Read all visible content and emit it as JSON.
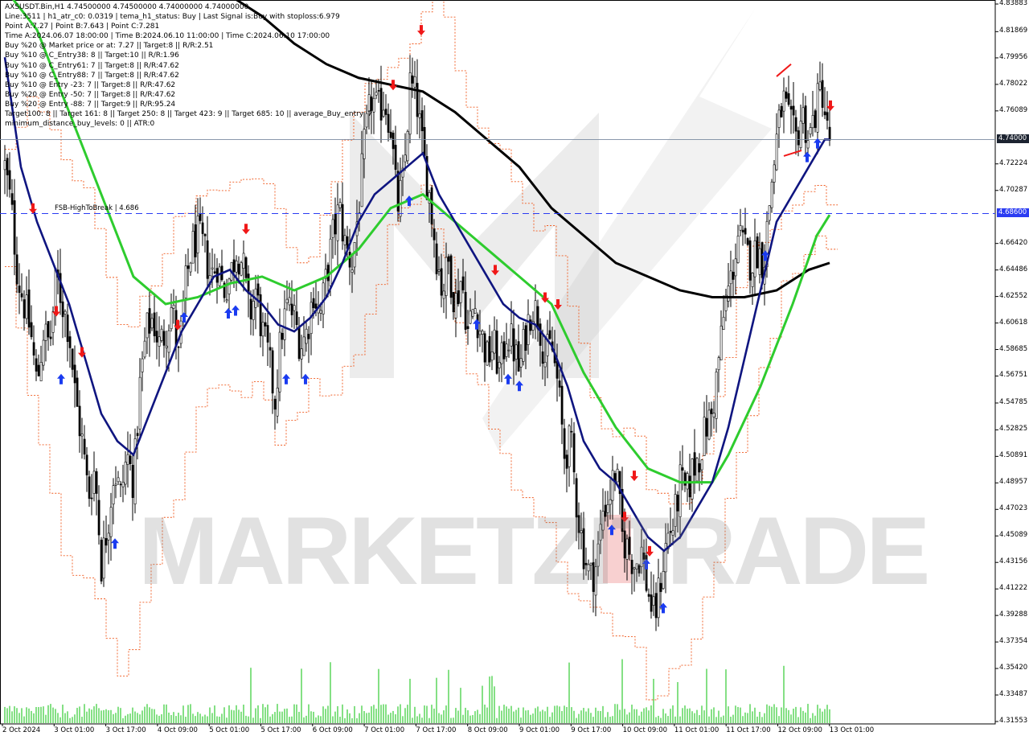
{
  "info": {
    "lines": [
      "AXSUSDT.Bin,H1  4.74500000 4.74500000 4.74000000 4.74000000",
      "Line:3511  | h1_atr_c0: 0.0319  | tema_h1_status: Buy  | Last Signal is:Buy with stoploss:6.979",
      "Point A:7.27  | Point B:7.643  | Point C:7.281",
      "Time A:2024.06.07 18:00:00  | Time B:2024.06.10 11:00:00  | Time C:2024.06.10 17:00:00",
      "Buy %20 @ Market price or at: 7.27  || Target:8  || R/R:2.51",
      "Buy %10 @ C_Entry38: 8  || Target:10  || R/R:1.96",
      "Buy %10 @ C_Entry61: 7  || Target:8  || R/R:47.62",
      "Buy %10 @ C_Entry88: 7  || Target:8  || R/R:47.62",
      "Buy %10 @ Entry -23: 7  || Target:8  || R/R:47.62",
      "Buy %20 @ Entry -50: 7  || Target:8  || R/R:47.62",
      "Buy %20 @ Entry -88: 7  || Target:9  || R/R:95.24",
      "Target100: 8  || Target 161: 8  || Target 250: 8  || Target 423: 9  || Target 685: 10  || average_Buy_entry: 7",
      "minimum_distance_buy_levels: 0  || ATR:0"
    ]
  },
  "fsb_label": "FSB-HighToBreak  | 4.686",
  "watermark": "MARKETZITRADE",
  "price_tags": {
    "current": "4.74000",
    "level": "4.68600"
  },
  "colors": {
    "bull": "#000000",
    "bear": "#000000",
    "ema_fast": "#0f1580",
    "ema_mid": "#2ecc2e",
    "ema_slow": "#000000",
    "envelope": "#f05a1e",
    "volume": "#33cc33",
    "buy_arrow": "#1a3bf0",
    "sell_arrow": "#f01818",
    "level_line": "#2b3cf2"
  },
  "chart_data": {
    "type": "candlestick",
    "symbol": "AXSUSDT.Bin",
    "timeframe": "H1",
    "ylim": [
      4.31553,
      4.83883
    ],
    "y_ticks": [
      "4.83883",
      "4.81869",
      "4.79956",
      "4.78022",
      "4.76089",
      "4.74000",
      "4.72224",
      "4.70287",
      "4.68600",
      "4.66420",
      "4.64486",
      "4.62552",
      "4.60618",
      "4.58685",
      "4.56751",
      "4.54785",
      "4.52825",
      "4.50891",
      "4.48957",
      "4.47023",
      "4.45089",
      "4.43156",
      "4.41222",
      "4.39288",
      "4.37354",
      "4.35420",
      "4.33487",
      "4.31553"
    ],
    "x_ticks": [
      "2 Oct 2024",
      "3 Oct 01:00",
      "3 Oct 17:00",
      "4 Oct 09:00",
      "5 Oct 01:00",
      "5 Oct 17:00",
      "6 Oct 09:00",
      "7 Oct 01:00",
      "7 Oct 17:00",
      "8 Oct 09:00",
      "9 Oct 01:00",
      "9 Oct 17:00",
      "10 Oct 09:00",
      "11 Oct 01:00",
      "11 Oct 17:00",
      "12 Oct 09:00",
      "13 Oct 01:00"
    ],
    "horizontal_levels": [
      {
        "name": "current price",
        "value": 4.74
      },
      {
        "name": "FSB-HighToBreak",
        "value": 4.686
      }
    ],
    "close_path": [
      [
        0,
        4.72
      ],
      [
        8,
        4.69
      ],
      [
        16,
        4.64
      ],
      [
        24,
        4.62
      ],
      [
        32,
        4.6
      ],
      [
        40,
        4.56
      ],
      [
        48,
        4.6
      ],
      [
        56,
        4.59
      ],
      [
        64,
        4.64
      ],
      [
        72,
        4.62
      ],
      [
        80,
        4.6
      ],
      [
        88,
        4.55
      ],
      [
        96,
        4.52
      ],
      [
        104,
        4.48
      ],
      [
        112,
        4.5
      ],
      [
        120,
        4.43
      ],
      [
        128,
        4.46
      ],
      [
        136,
        4.5
      ],
      [
        144,
        4.48
      ],
      [
        152,
        4.51
      ],
      [
        160,
        4.49
      ],
      [
        168,
        4.56
      ],
      [
        176,
        4.6
      ],
      [
        184,
        4.61
      ],
      [
        192,
        4.59
      ],
      [
        200,
        4.6
      ],
      [
        208,
        4.62
      ],
      [
        216,
        4.58
      ],
      [
        224,
        4.63
      ],
      [
        232,
        4.66
      ],
      [
        240,
        4.67
      ],
      [
        248,
        4.66
      ],
      [
        256,
        4.64
      ],
      [
        264,
        4.65
      ],
      [
        272,
        4.63
      ],
      [
        280,
        4.64
      ],
      [
        288,
        4.66
      ],
      [
        296,
        4.65
      ],
      [
        304,
        4.61
      ],
      [
        312,
        4.63
      ],
      [
        320,
        4.6
      ],
      [
        328,
        4.58
      ],
      [
        336,
        4.55
      ],
      [
        344,
        4.6
      ],
      [
        352,
        4.62
      ],
      [
        360,
        4.61
      ],
      [
        368,
        4.59
      ],
      [
        376,
        4.6
      ],
      [
        384,
        4.63
      ],
      [
        392,
        4.61
      ],
      [
        400,
        4.64
      ],
      [
        408,
        4.67
      ],
      [
        416,
        4.69
      ],
      [
        424,
        4.66
      ],
      [
        432,
        4.65
      ],
      [
        440,
        4.69
      ],
      [
        448,
        4.74
      ],
      [
        456,
        4.77
      ],
      [
        464,
        4.76
      ],
      [
        472,
        4.77
      ],
      [
        480,
        4.75
      ],
      [
        488,
        4.69
      ],
      [
        496,
        4.71
      ],
      [
        504,
        4.78
      ],
      [
        512,
        4.77
      ],
      [
        520,
        4.73
      ],
      [
        528,
        4.7
      ],
      [
        536,
        4.66
      ],
      [
        544,
        4.63
      ],
      [
        552,
        4.65
      ],
      [
        560,
        4.62
      ],
      [
        568,
        4.64
      ],
      [
        576,
        4.6
      ],
      [
        584,
        4.62
      ],
      [
        592,
        4.6
      ],
      [
        600,
        4.58
      ],
      [
        608,
        4.59
      ],
      [
        616,
        4.57
      ],
      [
        624,
        4.6
      ],
      [
        632,
        4.59
      ],
      [
        640,
        4.57
      ],
      [
        648,
        4.6
      ],
      [
        656,
        4.62
      ],
      [
        664,
        4.61
      ],
      [
        672,
        4.58
      ],
      [
        680,
        4.59
      ],
      [
        688,
        4.56
      ],
      [
        696,
        4.51
      ],
      [
        704,
        4.52
      ],
      [
        712,
        4.47
      ],
      [
        720,
        4.44
      ],
      [
        728,
        4.42
      ],
      [
        736,
        4.43
      ],
      [
        744,
        4.47
      ],
      [
        752,
        4.48
      ],
      [
        760,
        4.5
      ],
      [
        768,
        4.45
      ],
      [
        776,
        4.44
      ],
      [
        784,
        4.43
      ],
      [
        792,
        4.44
      ],
      [
        800,
        4.41
      ],
      [
        808,
        4.39
      ],
      [
        816,
        4.42
      ],
      [
        824,
        4.45
      ],
      [
        832,
        4.46
      ],
      [
        840,
        4.49
      ],
      [
        848,
        4.48
      ],
      [
        856,
        4.5
      ],
      [
        864,
        4.51
      ],
      [
        872,
        4.53
      ],
      [
        880,
        4.54
      ],
      [
        888,
        4.58
      ],
      [
        896,
        4.62
      ],
      [
        904,
        4.64
      ],
      [
        912,
        4.67
      ],
      [
        920,
        4.66
      ],
      [
        928,
        4.65
      ],
      [
        936,
        4.66
      ],
      [
        944,
        4.65
      ],
      [
        952,
        4.7
      ],
      [
        960,
        4.74
      ],
      [
        968,
        4.77
      ],
      [
        976,
        4.75
      ],
      [
        984,
        4.74
      ],
      [
        992,
        4.76
      ],
      [
        1000,
        4.74
      ],
      [
        1008,
        4.76
      ],
      [
        1016,
        4.78
      ],
      [
        1024,
        4.74
      ]
    ],
    "ema_fast": [
      [
        0,
        4.8
      ],
      [
        20,
        4.72
      ],
      [
        40,
        4.68
      ],
      [
        60,
        4.65
      ],
      [
        80,
        4.62
      ],
      [
        100,
        4.58
      ],
      [
        120,
        4.54
      ],
      [
        140,
        4.52
      ],
      [
        160,
        4.51
      ],
      [
        180,
        4.54
      ],
      [
        200,
        4.57
      ],
      [
        220,
        4.6
      ],
      [
        240,
        4.62
      ],
      [
        260,
        4.64
      ],
      [
        280,
        4.645
      ],
      [
        300,
        4.63
      ],
      [
        320,
        4.62
      ],
      [
        340,
        4.605
      ],
      [
        360,
        4.6
      ],
      [
        380,
        4.61
      ],
      [
        400,
        4.625
      ],
      [
        420,
        4.65
      ],
      [
        440,
        4.68
      ],
      [
        460,
        4.7
      ],
      [
        480,
        4.71
      ],
      [
        500,
        4.72
      ],
      [
        520,
        4.73
      ],
      [
        540,
        4.7
      ],
      [
        560,
        4.68
      ],
      [
        580,
        4.66
      ],
      [
        600,
        4.64
      ],
      [
        620,
        4.62
      ],
      [
        640,
        4.61
      ],
      [
        660,
        4.605
      ],
      [
        680,
        4.59
      ],
      [
        700,
        4.56
      ],
      [
        720,
        4.52
      ],
      [
        740,
        4.5
      ],
      [
        760,
        4.49
      ],
      [
        780,
        4.47
      ],
      [
        800,
        4.45
      ],
      [
        820,
        4.44
      ],
      [
        840,
        4.45
      ],
      [
        860,
        4.47
      ],
      [
        880,
        4.49
      ],
      [
        900,
        4.53
      ],
      [
        920,
        4.58
      ],
      [
        940,
        4.63
      ],
      [
        960,
        4.68
      ],
      [
        980,
        4.7
      ],
      [
        1000,
        4.72
      ],
      [
        1020,
        4.74
      ],
      [
        1026,
        4.74
      ]
    ],
    "ema_mid": [
      [
        0,
        4.85
      ],
      [
        40,
        4.82
      ],
      [
        80,
        4.76
      ],
      [
        120,
        4.7
      ],
      [
        160,
        4.64
      ],
      [
        200,
        4.62
      ],
      [
        240,
        4.625
      ],
      [
        280,
        4.635
      ],
      [
        320,
        4.64
      ],
      [
        360,
        4.63
      ],
      [
        400,
        4.64
      ],
      [
        440,
        4.66
      ],
      [
        480,
        4.69
      ],
      [
        520,
        4.7
      ],
      [
        560,
        4.68
      ],
      [
        600,
        4.66
      ],
      [
        640,
        4.64
      ],
      [
        680,
        4.62
      ],
      [
        720,
        4.57
      ],
      [
        760,
        4.53
      ],
      [
        800,
        4.5
      ],
      [
        840,
        4.49
      ],
      [
        880,
        4.49
      ],
      [
        900,
        4.51
      ],
      [
        940,
        4.56
      ],
      [
        980,
        4.62
      ],
      [
        1010,
        4.67
      ],
      [
        1026,
        4.685
      ]
    ],
    "ema_slow": [
      [
        160,
        4.86
      ],
      [
        200,
        4.855
      ],
      [
        240,
        4.85
      ],
      [
        280,
        4.845
      ],
      [
        320,
        4.83
      ],
      [
        360,
        4.81
      ],
      [
        400,
        4.795
      ],
      [
        440,
        4.785
      ],
      [
        480,
        4.78
      ],
      [
        520,
        4.775
      ],
      [
        560,
        4.76
      ],
      [
        600,
        4.74
      ],
      [
        640,
        4.72
      ],
      [
        680,
        4.69
      ],
      [
        720,
        4.67
      ],
      [
        760,
        4.65
      ],
      [
        800,
        4.64
      ],
      [
        840,
        4.63
      ],
      [
        880,
        4.625
      ],
      [
        920,
        4.625
      ],
      [
        960,
        4.63
      ],
      [
        1000,
        4.645
      ],
      [
        1026,
        4.65
      ]
    ],
    "envelope_upper": [
      [
        0,
        4.73
      ],
      [
        20,
        4.76
      ],
      [
        40,
        4.77
      ],
      [
        60,
        4.74
      ],
      [
        80,
        4.7
      ],
      [
        100,
        4.7
      ],
      [
        120,
        4.65
      ],
      [
        140,
        4.6
      ],
      [
        160,
        4.61
      ],
      [
        180,
        4.64
      ],
      [
        200,
        4.66
      ],
      [
        220,
        4.69
      ],
      [
        240,
        4.7
      ],
      [
        260,
        4.7
      ],
      [
        280,
        4.7
      ],
      [
        300,
        4.71
      ],
      [
        320,
        4.7
      ],
      [
        340,
        4.68
      ],
      [
        360,
        4.66
      ],
      [
        380,
        4.66
      ],
      [
        400,
        4.7
      ],
      [
        420,
        4.73
      ],
      [
        440,
        4.77
      ],
      [
        460,
        4.79
      ],
      [
        480,
        4.8
      ],
      [
        500,
        4.81
      ],
      [
        520,
        4.83
      ],
      [
        540,
        4.84
      ],
      [
        560,
        4.8
      ],
      [
        580,
        4.76
      ],
      [
        600,
        4.74
      ],
      [
        620,
        4.72
      ],
      [
        640,
        4.7
      ],
      [
        660,
        4.68
      ],
      [
        680,
        4.66
      ],
      [
        700,
        4.62
      ],
      [
        720,
        4.57
      ],
      [
        740,
        4.54
      ],
      [
        760,
        4.53
      ],
      [
        780,
        4.52
      ],
      [
        800,
        4.49
      ],
      [
        820,
        4.47
      ],
      [
        840,
        4.48
      ],
      [
        860,
        4.5
      ],
      [
        880,
        4.54
      ],
      [
        900,
        4.6
      ],
      [
        920,
        4.65
      ],
      [
        940,
        4.67
      ],
      [
        960,
        4.69
      ],
      [
        980,
        4.7
      ],
      [
        1000,
        4.7
      ],
      [
        1026,
        4.7
      ]
    ],
    "envelope_lower": [
      [
        0,
        4.64
      ],
      [
        20,
        4.58
      ],
      [
        40,
        4.52
      ],
      [
        60,
        4.46
      ],
      [
        80,
        4.43
      ],
      [
        100,
        4.42
      ],
      [
        120,
        4.38
      ],
      [
        140,
        4.34
      ],
      [
        160,
        4.38
      ],
      [
        180,
        4.43
      ],
      [
        200,
        4.47
      ],
      [
        220,
        4.5
      ],
      [
        240,
        4.54
      ],
      [
        260,
        4.56
      ],
      [
        280,
        4.56
      ],
      [
        300,
        4.56
      ],
      [
        320,
        4.55
      ],
      [
        340,
        4.52
      ],
      [
        360,
        4.54
      ],
      [
        380,
        4.56
      ],
      [
        400,
        4.56
      ],
      [
        420,
        4.57
      ],
      [
        440,
        4.58
      ],
      [
        460,
        4.64
      ],
      [
        480,
        4.68
      ],
      [
        500,
        4.69
      ],
      [
        520,
        4.7
      ],
      [
        540,
        4.66
      ],
      [
        560,
        4.61
      ],
      [
        580,
        4.56
      ],
      [
        600,
        4.54
      ],
      [
        620,
        4.5
      ],
      [
        640,
        4.48
      ],
      [
        660,
        4.47
      ],
      [
        680,
        4.44
      ],
      [
        700,
        4.41
      ],
      [
        720,
        4.4
      ],
      [
        740,
        4.39
      ],
      [
        760,
        4.38
      ],
      [
        780,
        4.37
      ],
      [
        800,
        4.33
      ],
      [
        820,
        4.34
      ],
      [
        840,
        4.36
      ],
      [
        860,
        4.39
      ],
      [
        880,
        4.43
      ],
      [
        900,
        4.49
      ],
      [
        920,
        4.54
      ],
      [
        940,
        4.58
      ],
      [
        960,
        4.62
      ],
      [
        980,
        4.65
      ],
      [
        1000,
        4.66
      ],
      [
        1026,
        4.67
      ]
    ],
    "signals": [
      {
        "type": "sell",
        "bar": 35,
        "price": 4.69
      },
      {
        "type": "sell",
        "bar": 64,
        "price": 4.615
      },
      {
        "type": "buy",
        "bar": 70,
        "price": 4.565
      },
      {
        "type": "sell",
        "bar": 96,
        "price": 4.585
      },
      {
        "type": "buy",
        "bar": 137,
        "price": 4.445
      },
      {
        "type": "buy",
        "bar": 223,
        "price": 4.61
      },
      {
        "type": "sell",
        "bar": 215,
        "price": 4.605
      },
      {
        "type": "buy",
        "bar": 278,
        "price": 4.613
      },
      {
        "type": "buy",
        "bar": 287,
        "price": 4.615
      },
      {
        "type": "sell",
        "bar": 300,
        "price": 4.675
      },
      {
        "type": "buy",
        "bar": 350,
        "price": 4.565
      },
      {
        "type": "buy",
        "bar": 374,
        "price": 4.565
      },
      {
        "type": "sell",
        "bar": 483,
        "price": 4.78
      },
      {
        "type": "buy",
        "bar": 503,
        "price": 4.695
      },
      {
        "type": "sell",
        "bar": 518,
        "price": 4.82
      },
      {
        "type": "buy",
        "bar": 587,
        "price": 4.605
      },
      {
        "type": "sell",
        "bar": 610,
        "price": 4.645
      },
      {
        "type": "buy",
        "bar": 626,
        "price": 4.565
      },
      {
        "type": "buy",
        "bar": 640,
        "price": 4.56
      },
      {
        "type": "sell",
        "bar": 672,
        "price": 4.625
      },
      {
        "type": "sell",
        "bar": 688,
        "price": 4.62
      },
      {
        "type": "buy",
        "bar": 755,
        "price": 4.455
      },
      {
        "type": "sell",
        "bar": 771,
        "price": 4.465
      },
      {
        "type": "sell",
        "bar": 783,
        "price": 4.495
      },
      {
        "type": "buy",
        "bar": 798,
        "price": 4.43
      },
      {
        "type": "sell",
        "bar": 802,
        "price": 4.44
      },
      {
        "type": "buy",
        "bar": 819,
        "price": 4.398
      },
      {
        "type": "buy",
        "bar": 946,
        "price": 4.655
      },
      {
        "type": "buy",
        "bar": 998,
        "price": 4.727
      },
      {
        "type": "buy",
        "bar": 1011,
        "price": 4.737
      },
      {
        "type": "sell",
        "bar": 1027,
        "price": 4.765
      }
    ]
  }
}
